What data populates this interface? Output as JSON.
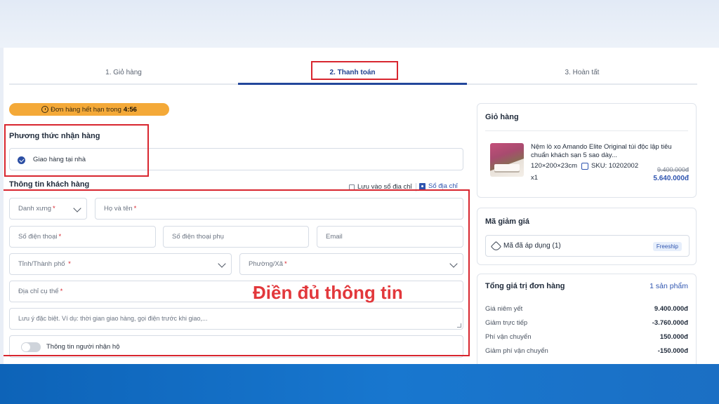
{
  "steps": [
    {
      "label": "1. Giỏ hàng"
    },
    {
      "label": "2. Thanh toán"
    },
    {
      "label": "3. Hoàn tất"
    }
  ],
  "timer": {
    "prefix": "Đơn hàng hết hạn trong",
    "time": "4:56"
  },
  "delivery": {
    "title": "Phương thức nhận hàng",
    "option": "Giao hàng tại nhà"
  },
  "customer": {
    "title": "Thông tin khách hàng",
    "save_address": "Lưu vào sổ địa chỉ",
    "address_book": "Sổ địa chỉ",
    "fields": {
      "salutation": "Danh xưng",
      "full_name": "Họ và tên",
      "phone": "Số điện thoại",
      "phone_alt": "Số điện thoại phụ",
      "email": "Email",
      "province": "Tỉnh/Thành phố",
      "ward": "Phường/Xã",
      "address": "Địa chỉ cụ thể",
      "note": "Lưu ý đặc biệt. Ví dụ: thời gian giao hàng, gọi điện trước khi giao,..."
    },
    "receiver_toggle": "Thông tin người nhận hộ"
  },
  "annotation": "Điền đủ thông tin",
  "cart": {
    "title": "Giỏ hàng",
    "product_name": "Nệm lò xo Amando Elite Original túi độc lập tiêu chuẩn khách sạn 5 sao dày...",
    "size": "120×200×23cm",
    "sku": "SKU: 10202002",
    "qty": "x1",
    "old_price": "9.400.000đ",
    "new_price": "5.640.000đ"
  },
  "coupon": {
    "title": "Mã giảm giá",
    "label": "Mã đã áp dụng (1)",
    "badge": "Freeship"
  },
  "totals": {
    "title": "Tổng giá trị đơn hàng",
    "count": "1 sản phẩm",
    "rows": [
      {
        "label": "Giá niêm yết",
        "value": "9.400.000đ"
      },
      {
        "label": "Giảm trực tiếp",
        "value": "-3.760.000đ"
      },
      {
        "label": "Phí vận chuyển",
        "value": "150.000đ"
      },
      {
        "label": "Giảm phí vận chuyển",
        "value": "-150.000đ"
      }
    ]
  },
  "colors": {
    "accent": "#23479b",
    "highlight": "#d8262f",
    "timer": "#f4a938",
    "band": "#1877cf"
  }
}
